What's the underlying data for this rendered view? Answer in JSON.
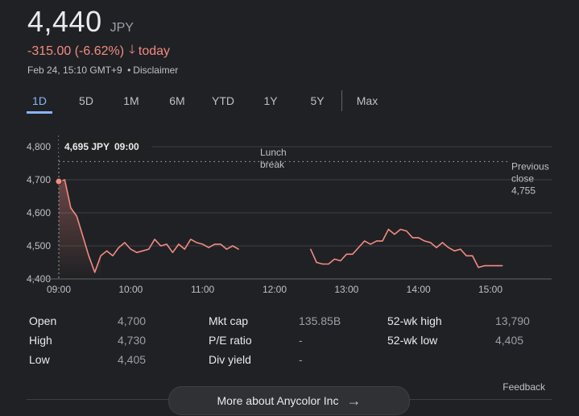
{
  "quote": {
    "price": "4,440",
    "currency": "JPY",
    "change": "-315.00 (-6.62%)",
    "direction_icon": "arrow-down-icon",
    "period": "today",
    "timestamp": "Feb 24, 15:10 GMT+9",
    "separator": "•",
    "disclaimer": "Disclaimer"
  },
  "tabs": [
    {
      "label": "1D",
      "active": true
    },
    {
      "label": "5D",
      "active": false
    },
    {
      "label": "1M",
      "active": false
    },
    {
      "label": "6M",
      "active": false
    },
    {
      "label": "YTD",
      "active": false
    },
    {
      "label": "1Y",
      "active": false
    },
    {
      "label": "5Y",
      "active": false
    },
    {
      "label": "Max",
      "active": false
    }
  ],
  "colors": {
    "line": "#f28b82",
    "negative": "#f28b82",
    "accent": "#8ab4f8",
    "grid": "#3c4043",
    "text_muted": "#9aa0a6"
  },
  "chart_data": {
    "type": "line",
    "yticks": [
      "4,800",
      "4,700",
      "4,600",
      "4,500",
      "4,400"
    ],
    "ylim": [
      4400,
      4800
    ],
    "xticks": [
      "09:00",
      "10:00",
      "11:00",
      "12:00",
      "13:00",
      "14:00",
      "15:00"
    ],
    "tooltip": {
      "price": "4,695 JPY",
      "time": "09:00"
    },
    "lunch_break_label": [
      "Lunch",
      "break"
    ],
    "previous_close": {
      "label": [
        "Previous",
        "close"
      ],
      "value": "4,755",
      "number": 4755
    },
    "series": [
      {
        "points": [
          [
            "09:00",
            4695
          ],
          [
            "09:05",
            4700
          ],
          [
            "09:10",
            4615
          ],
          [
            "09:15",
            4590
          ],
          [
            "09:20",
            4530
          ],
          [
            "09:25",
            4470
          ],
          [
            "09:30",
            4420
          ],
          [
            "09:35",
            4470
          ],
          [
            "09:40",
            4485
          ],
          [
            "09:45",
            4470
          ],
          [
            "09:50",
            4495
          ],
          [
            "09:55",
            4510
          ],
          [
            "10:00",
            4490
          ],
          [
            "10:05",
            4480
          ],
          [
            "10:10",
            4485
          ],
          [
            "10:15",
            4490
          ],
          [
            "10:20",
            4520
          ],
          [
            "10:25",
            4500
          ],
          [
            "10:30",
            4505
          ],
          [
            "10:35",
            4480
          ],
          [
            "10:40",
            4505
          ],
          [
            "10:45",
            4490
          ],
          [
            "10:50",
            4520
          ],
          [
            "10:55",
            4510
          ],
          [
            "11:00",
            4505
          ],
          [
            "11:05",
            4495
          ],
          [
            "11:10",
            4505
          ],
          [
            "11:15",
            4505
          ],
          [
            "11:20",
            4490
          ],
          [
            "11:25",
            4500
          ],
          [
            "11:30",
            4490
          ]
        ]
      },
      {
        "points": [
          [
            "12:30",
            4490
          ],
          [
            "12:35",
            4450
          ],
          [
            "12:40",
            4445
          ],
          [
            "12:45",
            4445
          ],
          [
            "12:50",
            4460
          ],
          [
            "12:55",
            4455
          ],
          [
            "13:00",
            4475
          ],
          [
            "13:05",
            4475
          ],
          [
            "13:10",
            4495
          ],
          [
            "13:15",
            4515
          ],
          [
            "13:20",
            4505
          ],
          [
            "13:25",
            4515
          ],
          [
            "13:30",
            4515
          ],
          [
            "13:35",
            4550
          ],
          [
            "13:40",
            4535
          ],
          [
            "13:45",
            4550
          ],
          [
            "13:50",
            4545
          ],
          [
            "13:55",
            4525
          ],
          [
            "14:00",
            4525
          ],
          [
            "14:05",
            4515
          ],
          [
            "14:10",
            4510
          ],
          [
            "14:15",
            4495
          ],
          [
            "14:20",
            4510
          ],
          [
            "14:25",
            4495
          ],
          [
            "14:30",
            4485
          ],
          [
            "14:35",
            4490
          ],
          [
            "14:40",
            4470
          ],
          [
            "14:45",
            4470
          ],
          [
            "14:50",
            4435
          ],
          [
            "14:55",
            4440
          ],
          [
            "15:00",
            4440
          ],
          [
            "15:05",
            4440
          ],
          [
            "15:10",
            4440
          ]
        ]
      }
    ]
  },
  "stats": [
    {
      "label": "Open",
      "value": "4,700"
    },
    {
      "label": "High",
      "value": "4,730"
    },
    {
      "label": "Low",
      "value": "4,405"
    },
    {
      "label": "Mkt cap",
      "value": "135.85B"
    },
    {
      "label": "P/E ratio",
      "value": "-"
    },
    {
      "label": "Div yield",
      "value": "-"
    },
    {
      "label": "52-wk high",
      "value": "13,790"
    },
    {
      "label": "52-wk low",
      "value": "4,405"
    }
  ],
  "footer": {
    "feedback": "Feedback",
    "more_button": "More about Anycolor Inc",
    "more_icon": "arrow-right-icon"
  }
}
